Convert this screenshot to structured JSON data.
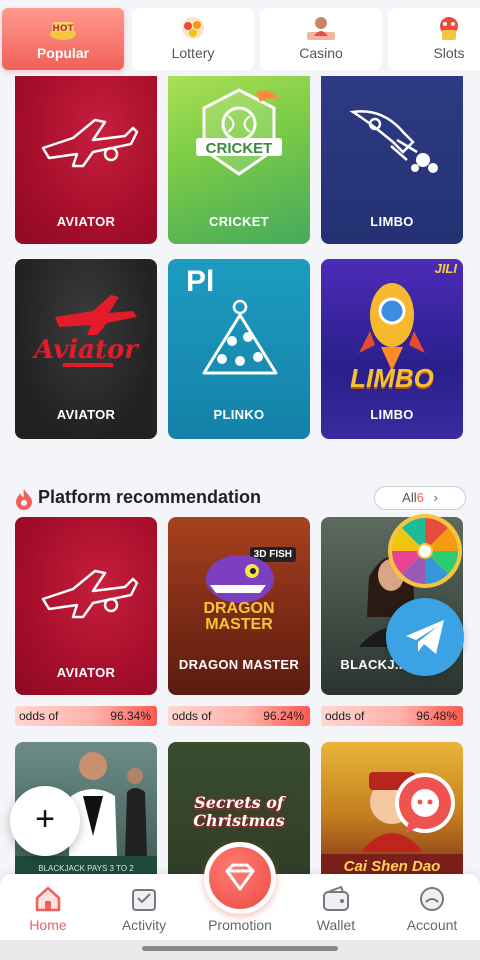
{
  "categories": [
    {
      "label": "Popular",
      "icon": "popular-icon",
      "active": true
    },
    {
      "label": "Lottery",
      "icon": "lottery-icon",
      "active": false
    },
    {
      "label": "Casino",
      "icon": "casino-icon",
      "active": false
    },
    {
      "label": "Slots",
      "icon": "slots-icon",
      "active": false
    }
  ],
  "games_top": [
    {
      "name": "AVIATOR",
      "style": "red",
      "icon": "plane-icon"
    },
    {
      "name": "CRICKET",
      "style": "green",
      "icon": "cricket-icon",
      "art_text": "CRICKET"
    },
    {
      "name": "LIMBO",
      "style": "navy",
      "icon": "rocket-icon"
    },
    {
      "name": "AVIATOR",
      "style": "dark",
      "icon": "aviator-logo-icon",
      "art_text": "Aviator"
    },
    {
      "name": "PLINKO",
      "style": "teal",
      "icon": "plinko-icon",
      "art_text": "Pl"
    },
    {
      "name": "LIMBO",
      "style": "purple",
      "icon": "limbo-rocket-icon",
      "art_text": "LIMBO",
      "badge": "JILI"
    }
  ],
  "platform": {
    "title": "Platform recommendation",
    "icon": "flame-icon",
    "all_label": "All",
    "all_count": "6",
    "games": [
      {
        "name": "AVIATOR",
        "odds_label": "odds of",
        "odds_value": "96.34%"
      },
      {
        "name": "DRAGON MASTER",
        "odds_label": "odds of",
        "odds_value": "96.24%",
        "art_text": "DRAGON MASTER",
        "badge": "3D FISH"
      },
      {
        "name": "BLACKJ... VIP 7",
        "odds_label": "odds of",
        "odds_value": "96.48%"
      }
    ],
    "row2": [
      {
        "name": "blackjack-dealer-game",
        "art_text": "BLACKJACK PAYS 3 TO 2"
      },
      {
        "name": "secrets-of-christmas",
        "art_text": "Secrets of Christmas"
      },
      {
        "name": "cai-shen-dao",
        "art_text": "Cai Shen Dao"
      }
    ]
  },
  "floating": {
    "plus_label": "+"
  },
  "nav": [
    {
      "label": "Home",
      "icon": "home-icon",
      "active": true
    },
    {
      "label": "Activity",
      "icon": "activity-icon",
      "active": false
    },
    {
      "label": "Promotion",
      "icon": "diamond-icon",
      "active": false
    },
    {
      "label": "Wallet",
      "icon": "wallet-icon",
      "active": false
    },
    {
      "label": "Account",
      "icon": "account-icon",
      "active": false
    }
  ],
  "colors": {
    "accent": "#f0605a",
    "tile_red": "#a50e2b",
    "telegram": "#3ba3e4"
  }
}
